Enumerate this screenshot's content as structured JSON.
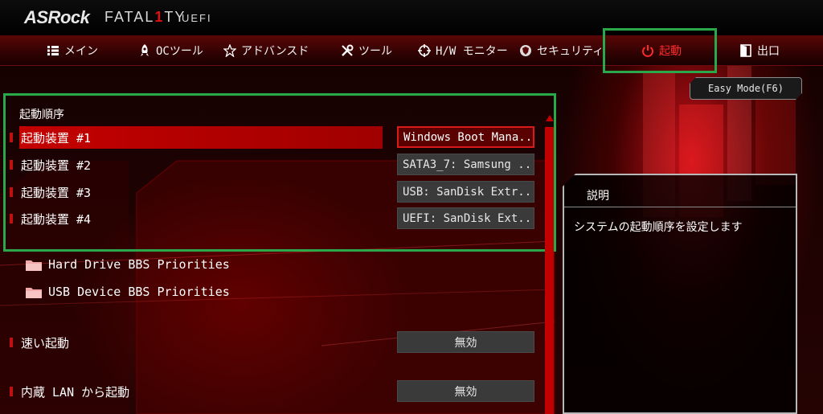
{
  "header": {
    "brand": "ASRock",
    "product_pre": "FATAL",
    "product_one": "1",
    "product_post": "TY",
    "uefi": "UEFI"
  },
  "tabs": [
    {
      "label": "メイン",
      "icon": "list-icon"
    },
    {
      "label": "OCツール",
      "icon": "rocket-icon"
    },
    {
      "label": "アドバンスド",
      "icon": "star-icon"
    },
    {
      "label": "ツール",
      "icon": "tools-icon"
    },
    {
      "label": "H/W モニター",
      "icon": "crosshair-icon"
    },
    {
      "label": "セキュリティ",
      "icon": "shield-icon"
    },
    {
      "label": "起動",
      "icon": "power-icon",
      "active": true
    },
    {
      "label": "出口",
      "icon": "exit-door-icon"
    }
  ],
  "easy_mode_label": "Easy Mode(F6)",
  "main": {
    "section_title": "起動順序",
    "boot_devices": [
      {
        "label": "起動装置 #1",
        "value": "Windows Boot Mana...",
        "selected": true
      },
      {
        "label": "起動装置 #2",
        "value": "SATA3_7: Samsung ..."
      },
      {
        "label": "起動装置 #3",
        "value": "USB: SanDisk Extr..."
      },
      {
        "label": "起動装置 #4",
        "value": "UEFI: SanDisk Ext..."
      }
    ],
    "folders": [
      {
        "label": "Hard Drive BBS Priorities"
      },
      {
        "label": "USB Device BBS Priorities"
      }
    ],
    "fast_boot": {
      "label": "速い起動",
      "value": "無効"
    },
    "lan_boot": {
      "label": "内蔵 LAN から起動",
      "value": "無効"
    }
  },
  "description": {
    "title": "説明",
    "text": "システムの起動順序を設定します"
  },
  "colors": {
    "accent_red": "#c40000",
    "highlight_green": "#2aa84a",
    "active_tab": "#ff2a2a"
  }
}
